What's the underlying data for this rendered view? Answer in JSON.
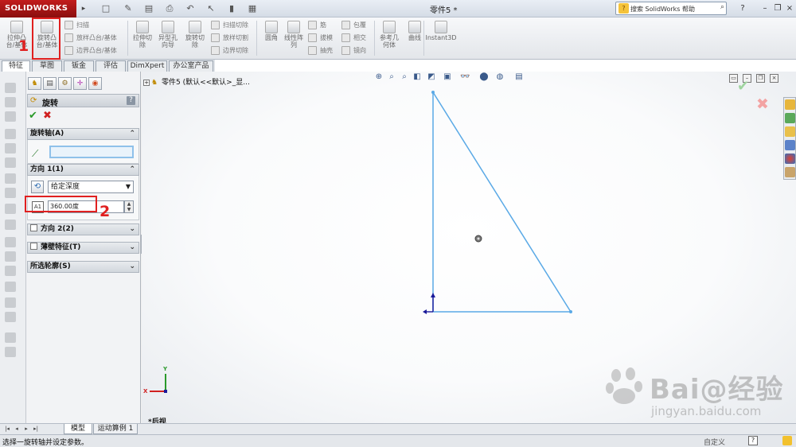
{
  "app": {
    "logo": "SOLIDWORKS",
    "document_title": "零件5 *",
    "search_placeholder": "搜索 SolidWorks 帮助"
  },
  "ribbon": {
    "big_tools": [
      {
        "label": "拉伸凸\n台/基体"
      },
      {
        "label": "旋转凸\n台/基体"
      },
      {
        "label": "拉伸切\n除"
      },
      {
        "label": "异型孔\n向导"
      },
      {
        "label": "旋转切\n除"
      },
      {
        "label": "圆角"
      },
      {
        "label": "线性阵\n列"
      },
      {
        "label": "参考几\n何体"
      },
      {
        "label": "曲线"
      },
      {
        "label": "Instant3D"
      }
    ],
    "small_tools": [
      {
        "label": "扫描"
      },
      {
        "label": "放样凸台/基体"
      },
      {
        "label": "边界凸台/基体"
      },
      {
        "label": "扫描切除"
      },
      {
        "label": "放样切割"
      },
      {
        "label": "边界切除"
      },
      {
        "label": "筋"
      },
      {
        "label": "拔模"
      },
      {
        "label": "抽壳"
      },
      {
        "label": "包覆"
      },
      {
        "label": "相交"
      },
      {
        "label": "镜向"
      }
    ]
  },
  "annotations": {
    "step1": "1",
    "step2": "2"
  },
  "tabs": [
    "特征",
    "草图",
    "钣金",
    "评估",
    "DimXpert",
    "办公室产品"
  ],
  "property_manager": {
    "title": "旋转",
    "help": "?",
    "axis_group": "旋转轴(A)",
    "direction1_group": "方向 1(1)",
    "end_condition": "给定深度",
    "angle_value": "360.00度",
    "direction2_group": "方向 2(2)",
    "thin_feature_group": "薄壁特征(T)",
    "contours_group": "所选轮廓(S)"
  },
  "tree": {
    "item": "零件5  (默认<<默认>_显..."
  },
  "viewport": {
    "view_name": "*后视",
    "triad": {
      "x": "X",
      "y": "Y"
    },
    "sketch_color": "#5aa9e6"
  },
  "watermark": {
    "text": "Bai@经验",
    "url": "jingyan.baidu.com"
  },
  "bottom_tabs": [
    "模型",
    "运动算例 1"
  ],
  "status": {
    "message": "选择一旋转轴并设定参数。",
    "units": "自定义",
    "help": "?"
  }
}
